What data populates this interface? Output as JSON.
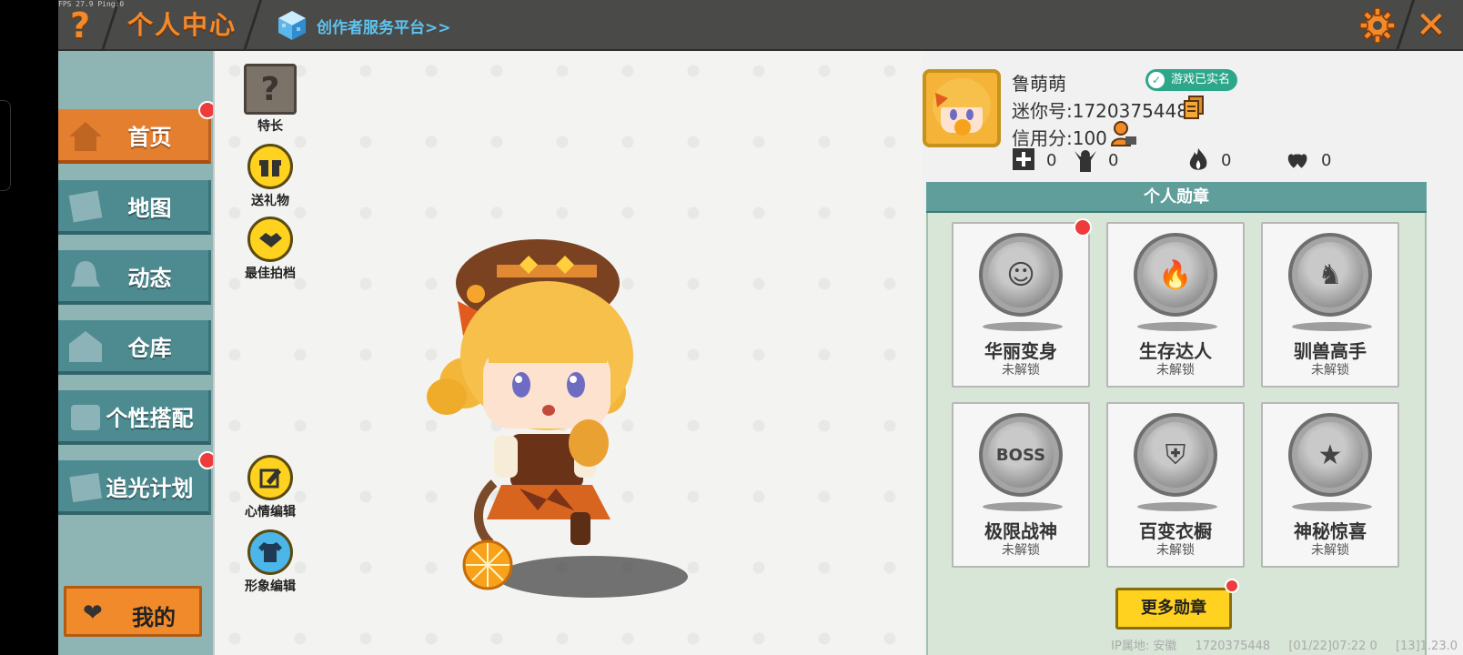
{
  "debug": {
    "fps": "FPS 27.9  Ping:0"
  },
  "header": {
    "title": "个人中心",
    "creator_platform": "创作者服务平台>>",
    "help_glyph": "?",
    "close_glyph": "✕"
  },
  "sidebar": {
    "items": [
      {
        "label": "首页",
        "active": true,
        "dot": true,
        "icon": "house-icon"
      },
      {
        "label": "地图",
        "active": false,
        "dot": false,
        "icon": "map-icon"
      },
      {
        "label": "动态",
        "active": false,
        "dot": false,
        "icon": "bell-icon"
      },
      {
        "label": "仓库",
        "active": false,
        "dot": false,
        "icon": "warehouse-icon"
      },
      {
        "label": "个性搭配",
        "active": false,
        "dot": false,
        "icon": "outfit-icon"
      },
      {
        "label": "追光计划",
        "active": false,
        "dot": true,
        "icon": "plan-icon"
      }
    ],
    "mine_label": "我的"
  },
  "actions": {
    "talent": "特长",
    "gift": "送礼物",
    "partner": "最佳拍档",
    "mood_edit": "心情编辑",
    "avatar_edit": "形象编辑"
  },
  "profile": {
    "name": "鲁萌萌",
    "verified": "游戏已实名",
    "mini_id": "迷你号:1720375448",
    "credit": "信用分:100",
    "stats": [
      {
        "icon": "add-friend-icon",
        "value": "0"
      },
      {
        "icon": "fans-icon",
        "value": "0"
      },
      {
        "icon": "flame-icon",
        "value": "0"
      },
      {
        "icon": "hearts-icon",
        "value": "0"
      }
    ]
  },
  "badges": {
    "title": "个人勋章",
    "items": [
      {
        "name": "华丽变身",
        "status": "未解锁",
        "glyph": "☺",
        "dot": true
      },
      {
        "name": "生存达人",
        "status": "未解锁",
        "glyph": "🔥",
        "dot": false
      },
      {
        "name": "驯兽高手",
        "status": "未解锁",
        "glyph": "♞",
        "dot": false
      },
      {
        "name": "极限战神",
        "status": "未解锁",
        "glyph": "BOSS",
        "dot": false
      },
      {
        "name": "百变衣橱",
        "status": "未解锁",
        "glyph": "⛨",
        "dot": false
      },
      {
        "name": "神秘惊喜",
        "status": "未解锁",
        "glyph": "★",
        "dot": false
      }
    ],
    "more": "更多勋章"
  },
  "footer": {
    "ip": "IP属地: 安徽",
    "uid": "1720375448",
    "time": "[01/22]07:22 0",
    "version": "[13]1.23.0"
  },
  "colors": {
    "accent": "#f4892a",
    "teal": "#4e8b91",
    "gold": "#ffd21f"
  }
}
